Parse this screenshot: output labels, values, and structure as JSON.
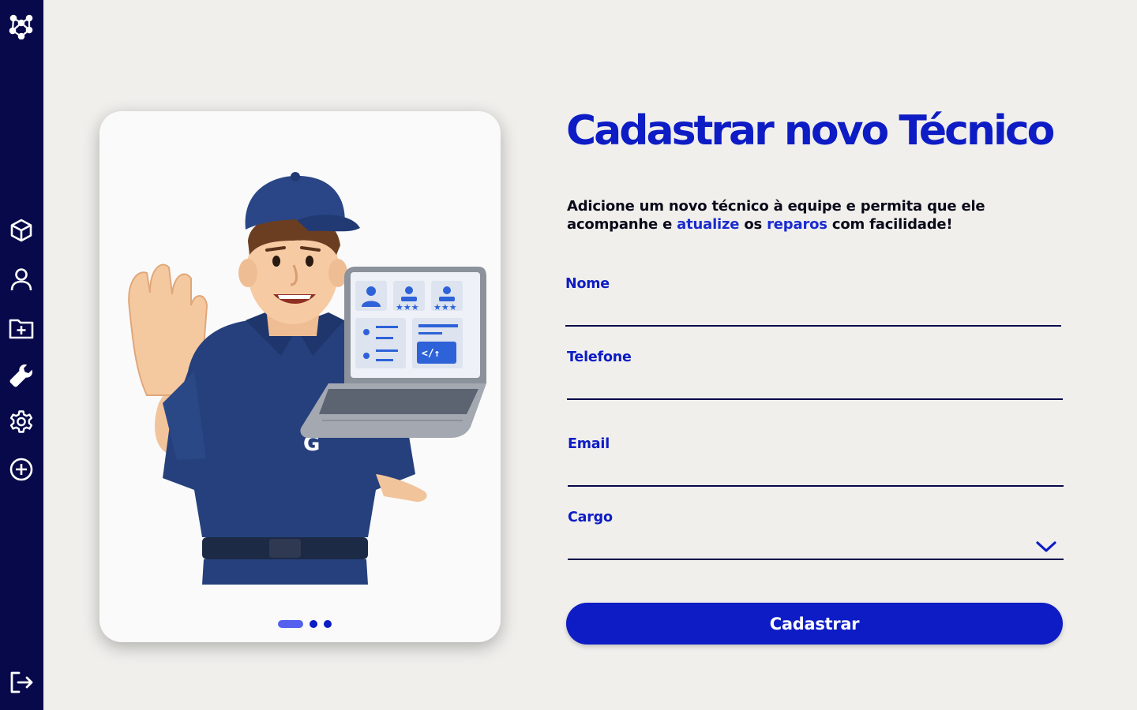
{
  "sidebar": {
    "logo_icon": "network-logo-icon",
    "items": [
      {
        "name": "box-icon"
      },
      {
        "name": "user-icon"
      },
      {
        "name": "folder-add-icon"
      },
      {
        "name": "wrench-icon"
      },
      {
        "name": "gear-icon"
      },
      {
        "name": "plus-circle-icon"
      }
    ],
    "logout_icon": "logout-icon"
  },
  "hero": {
    "carousel": {
      "count": 3,
      "active_index": 0
    }
  },
  "form": {
    "title": "Cadastrar novo Técnico",
    "subtitle": {
      "part1": "Adicione um novo técnico à equipe e permita que ele acompanhe e ",
      "link1": "atualize",
      "part2": " os ",
      "link2": "reparos",
      "part3": " com facilidade!"
    },
    "fields": {
      "nome": {
        "label": "Nome",
        "value": ""
      },
      "telefone": {
        "label": "Telefone",
        "value": ""
      },
      "email": {
        "label": "Email",
        "value": ""
      },
      "cargo": {
        "label": "Cargo",
        "value": ""
      }
    },
    "submit_label": "Cadastrar"
  },
  "colors": {
    "sidebar_bg": "#07094a",
    "accent": "#0d1cc4",
    "page_bg": "#f0efec"
  }
}
